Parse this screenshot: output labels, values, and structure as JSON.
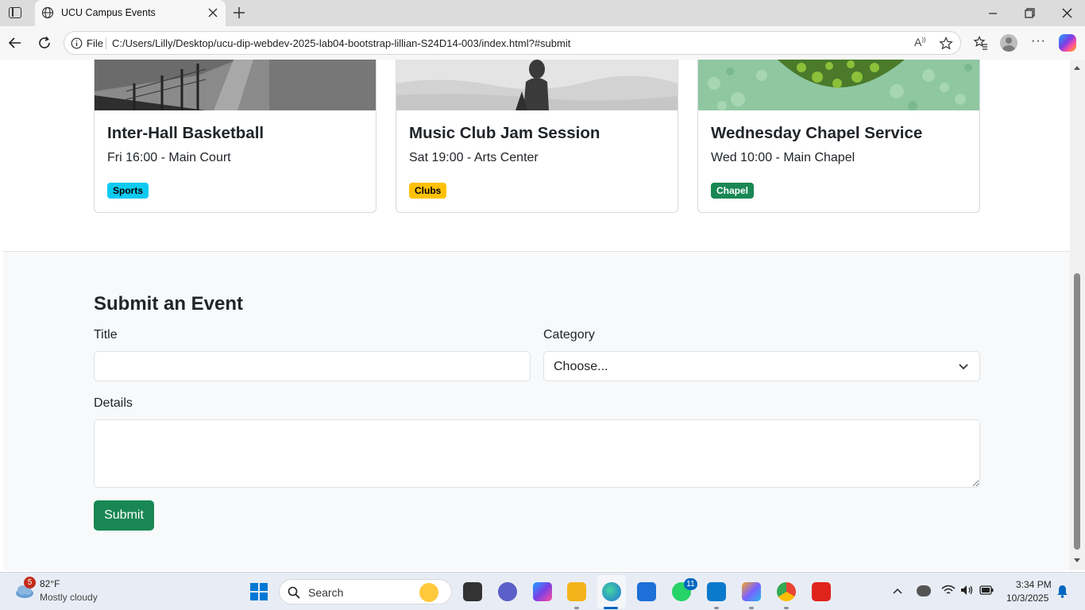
{
  "browser": {
    "tab_title": "UCU Campus Events",
    "file_label": "File",
    "url": "C:/Users/Lilly/Desktop/ucu-dip-webdev-2025-lab04-bootstrap-lillian-S24D14-003/index.html?#submit"
  },
  "events": [
    {
      "title": "Inter-Hall Basketball",
      "meta": "Fri 16:00 - Main Court",
      "badge": "Sports",
      "badge_color": "#0dcaf0",
      "badge_text_color": "#000000"
    },
    {
      "title": "Music Club Jam Session",
      "meta": "Sat 19:00 - Arts Center",
      "badge": "Clubs",
      "badge_color": "#ffc107",
      "badge_text_color": "#000000"
    },
    {
      "title": "Wednesday Chapel Service",
      "meta": "Wed 10:00 - Main Chapel",
      "badge": "Chapel",
      "badge_color": "#198754",
      "badge_text_color": "#ffffff"
    }
  ],
  "form": {
    "heading": "Submit an Event",
    "title_label": "Title",
    "title_value": "",
    "category_label": "Category",
    "category_selected": "Choose...",
    "details_label": "Details",
    "details_value": "",
    "submit_label": "Submit",
    "submit_color": "#198754"
  },
  "taskbar": {
    "weather_temp": "82°F",
    "weather_desc": "Mostly cloudy",
    "weather_badge": "5",
    "search_placeholder": "Search",
    "whatsapp_badge": "11",
    "time": "3:34 PM",
    "date": "10/3/2025"
  },
  "icons": [
    "sidebar-toggle-icon",
    "globe-icon",
    "close-icon",
    "plus-icon",
    "minimize-icon",
    "restore-icon",
    "window-close-icon",
    "back-icon",
    "refresh-icon",
    "info-icon",
    "read-aloud-icon",
    "favorite-star-icon",
    "favorites-icon",
    "profile-icon",
    "more-icon",
    "copilot-icon",
    "chevron-down-icon",
    "windows-start-icon",
    "search-icon",
    "task-view-icon",
    "notification-bell-icon",
    "wifi-icon",
    "volume-icon",
    "battery-icon"
  ]
}
